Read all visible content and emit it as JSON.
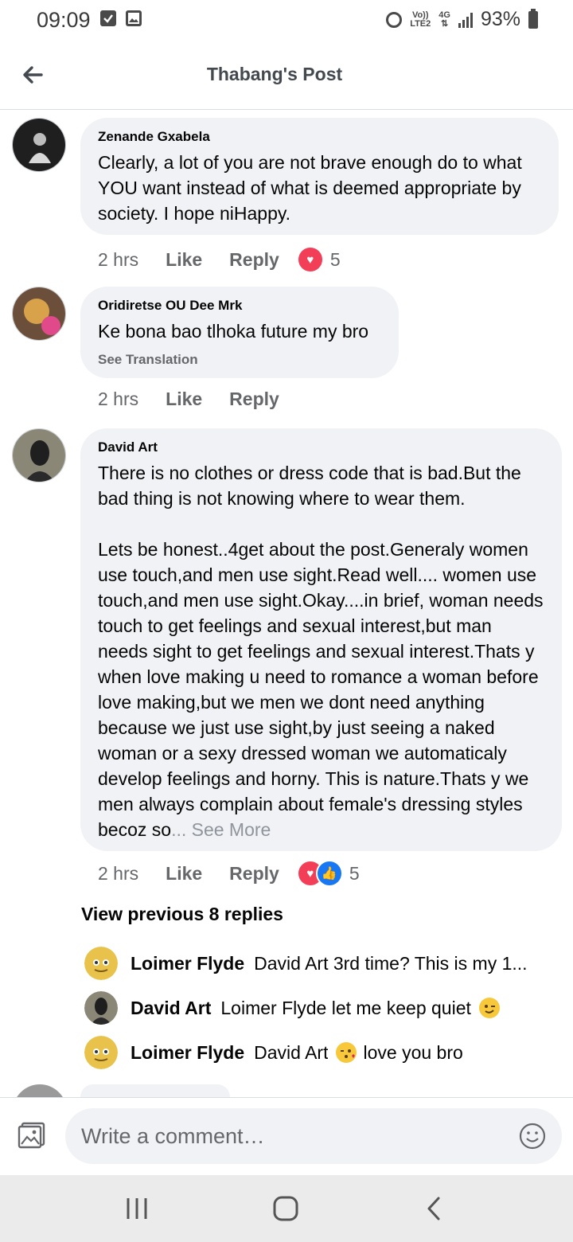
{
  "status_bar": {
    "time": "09:09",
    "volte_top": "Vo))",
    "volte_bottom": "LTE2",
    "network": "4G",
    "battery": "93%"
  },
  "header": {
    "title": "Thabang's Post"
  },
  "comments": [
    {
      "author": "Zenande Gxabela",
      "text": "Clearly, a lot of you are not brave enough do to what YOU want instead of what is deemed appropriate by society. I hope niHappy.",
      "time": "2 hrs",
      "like": "Like",
      "reply": "Reply",
      "reaction_count": "5"
    },
    {
      "author": "Oridiretse OU Dee Mrk",
      "text": "Ke bona bao tlhoka future my bro",
      "see_translation": "See Translation",
      "time": "2 hrs",
      "like": "Like",
      "reply": "Reply"
    },
    {
      "author": "David Art",
      "text": "There is no clothes or dress code that is bad.But the bad thing is not knowing where to wear them.\n\nLets be honest..4get about the post.Generaly women use touch,and men use sight.Read well.... women use touch,and men use sight.Okay....in brief, woman needs touch to get feelings and sexual interest,but man needs sight to get feelings and sexual interest.Thats y when love making u need to romance a woman before love making,but we men we dont need anything because we just use sight,by just seeing a naked woman or a sexy dressed woman we automaticaly develop feelings and horny. This is nature.Thats y we men always complain about female's dressing styles becoz so",
      "see_more": "... See More",
      "time": "2 hrs",
      "like": "Like",
      "reply": "Reply",
      "reaction_count": "5"
    }
  ],
  "view_previous": "View previous 8 replies",
  "replies": [
    {
      "name": "Loimer Flyde",
      "text_before": "David Art 3rd time? This is my 1...",
      "text_after": ""
    },
    {
      "name": "David Art",
      "text_before": "Loimer Flyde let me keep quiet",
      "text_after": ""
    },
    {
      "name": "Loimer Flyde",
      "text_before": "David Art",
      "text_after": "love you bro"
    }
  ],
  "composer": {
    "placeholder": "Write a comment…"
  },
  "colors": {
    "bubble": "#f0f2f5",
    "heart": "#f33e58",
    "like_blue": "#1877f2",
    "muted": "#65676b"
  }
}
